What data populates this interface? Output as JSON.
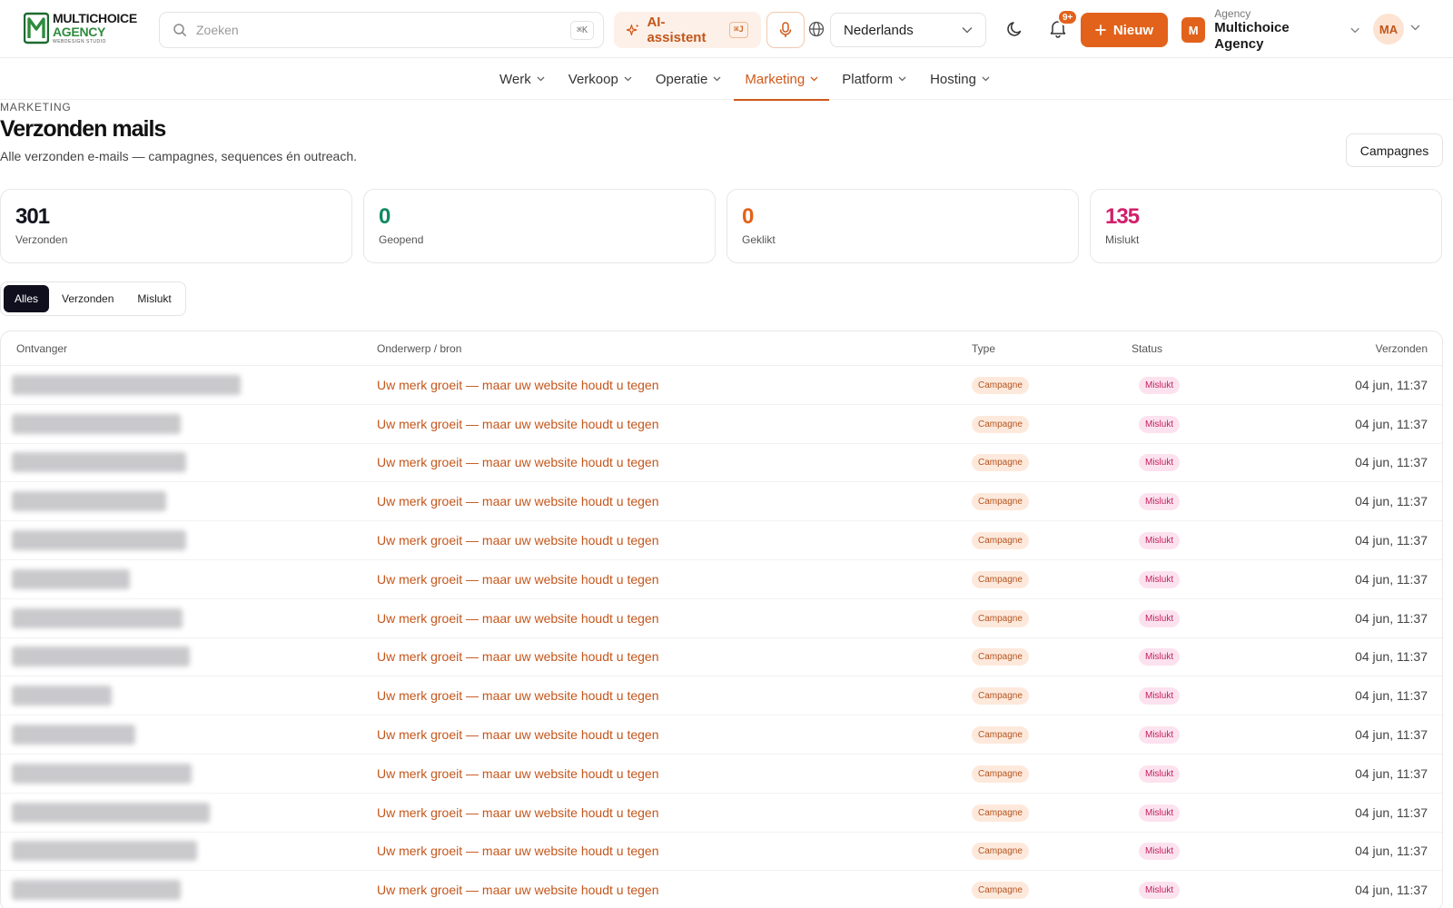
{
  "brand": {
    "line1": "MULTICHOICE",
    "line2": "AGENCY",
    "line3": "WEBDESIGN STUDIO"
  },
  "search": {
    "placeholder": "Zoeken",
    "shortcut": "⌘K"
  },
  "ai": {
    "label": "AI-assistent",
    "shortcut": "⌘J"
  },
  "language": {
    "selected": "Nederlands"
  },
  "notifications": {
    "badge": "9+"
  },
  "new_button": {
    "label": "Nieuw"
  },
  "org": {
    "avatar": "M",
    "sub": "Agency",
    "name": "Multichoice Agency"
  },
  "user": {
    "initials": "MA"
  },
  "nav": {
    "items": [
      {
        "label": "Werk"
      },
      {
        "label": "Verkoop"
      },
      {
        "label": "Operatie"
      },
      {
        "label": "Marketing"
      },
      {
        "label": "Platform"
      },
      {
        "label": "Hosting"
      }
    ]
  },
  "header": {
    "eyebrow": "MARKETING",
    "title": "Verzonden mails",
    "subtitle": "Alle verzonden e-mails — campagnes, sequences én outreach.",
    "campaigns_button": "Campagnes"
  },
  "stats": [
    {
      "value": "301",
      "label": "Verzonden",
      "color": "#12141f"
    },
    {
      "value": "0",
      "label": "Geopend",
      "color": "#0f8a5f"
    },
    {
      "value": "0",
      "label": "Geklikt",
      "color": "#e2621b"
    },
    {
      "value": "135",
      "label": "Mislukt",
      "color": "#d21f6a"
    }
  ],
  "filters": [
    {
      "label": "Alles"
    },
    {
      "label": "Verzonden"
    },
    {
      "label": "Mislukt"
    }
  ],
  "table": {
    "headers": {
      "recipient": "Ontvanger",
      "subject": "Onderwerp / bron",
      "type": "Type",
      "status": "Status",
      "sent": "Verzonden"
    },
    "rows": [
      {
        "subject": "Uw merk groeit — maar uw website houdt u tegen",
        "type": "Campagne",
        "status": "Mislukt",
        "sent": "04 jun, 11:37"
      },
      {
        "subject": "Uw merk groeit — maar uw website houdt u tegen",
        "type": "Campagne",
        "status": "Mislukt",
        "sent": "04 jun, 11:37"
      },
      {
        "subject": "Uw merk groeit — maar uw website houdt u tegen",
        "type": "Campagne",
        "status": "Mislukt",
        "sent": "04 jun, 11:37"
      },
      {
        "subject": "Uw merk groeit — maar uw website houdt u tegen",
        "type": "Campagne",
        "status": "Mislukt",
        "sent": "04 jun, 11:37"
      },
      {
        "subject": "Uw merk groeit — maar uw website houdt u tegen",
        "type": "Campagne",
        "status": "Mislukt",
        "sent": "04 jun, 11:37"
      },
      {
        "subject": "Uw merk groeit — maar uw website houdt u tegen",
        "type": "Campagne",
        "status": "Mislukt",
        "sent": "04 jun, 11:37"
      },
      {
        "subject": "Uw merk groeit — maar uw website houdt u tegen",
        "type": "Campagne",
        "status": "Mislukt",
        "sent": "04 jun, 11:37"
      },
      {
        "subject": "Uw merk groeit — maar uw website houdt u tegen",
        "type": "Campagne",
        "status": "Mislukt",
        "sent": "04 jun, 11:37"
      },
      {
        "subject": "Uw merk groeit — maar uw website houdt u tegen",
        "type": "Campagne",
        "status": "Mislukt",
        "sent": "04 jun, 11:37"
      },
      {
        "subject": "Uw merk groeit — maar uw website houdt u tegen",
        "type": "Campagne",
        "status": "Mislukt",
        "sent": "04 jun, 11:37"
      },
      {
        "subject": "Uw merk groeit — maar uw website houdt u tegen",
        "type": "Campagne",
        "status": "Mislukt",
        "sent": "04 jun, 11:37"
      },
      {
        "subject": "Uw merk groeit — maar uw website houdt u tegen",
        "type": "Campagne",
        "status": "Mislukt",
        "sent": "04 jun, 11:37"
      },
      {
        "subject": "Uw merk groeit — maar uw website houdt u tegen",
        "type": "Campagne",
        "status": "Mislukt",
        "sent": "04 jun, 11:37"
      },
      {
        "subject": "Uw merk groeit — maar uw website houdt u tegen",
        "type": "Campagne",
        "status": "Mislukt",
        "sent": "04 jun, 11:37"
      }
    ]
  },
  "colors": {
    "accent": "#e2621b",
    "dark": "#0f0f1e"
  }
}
